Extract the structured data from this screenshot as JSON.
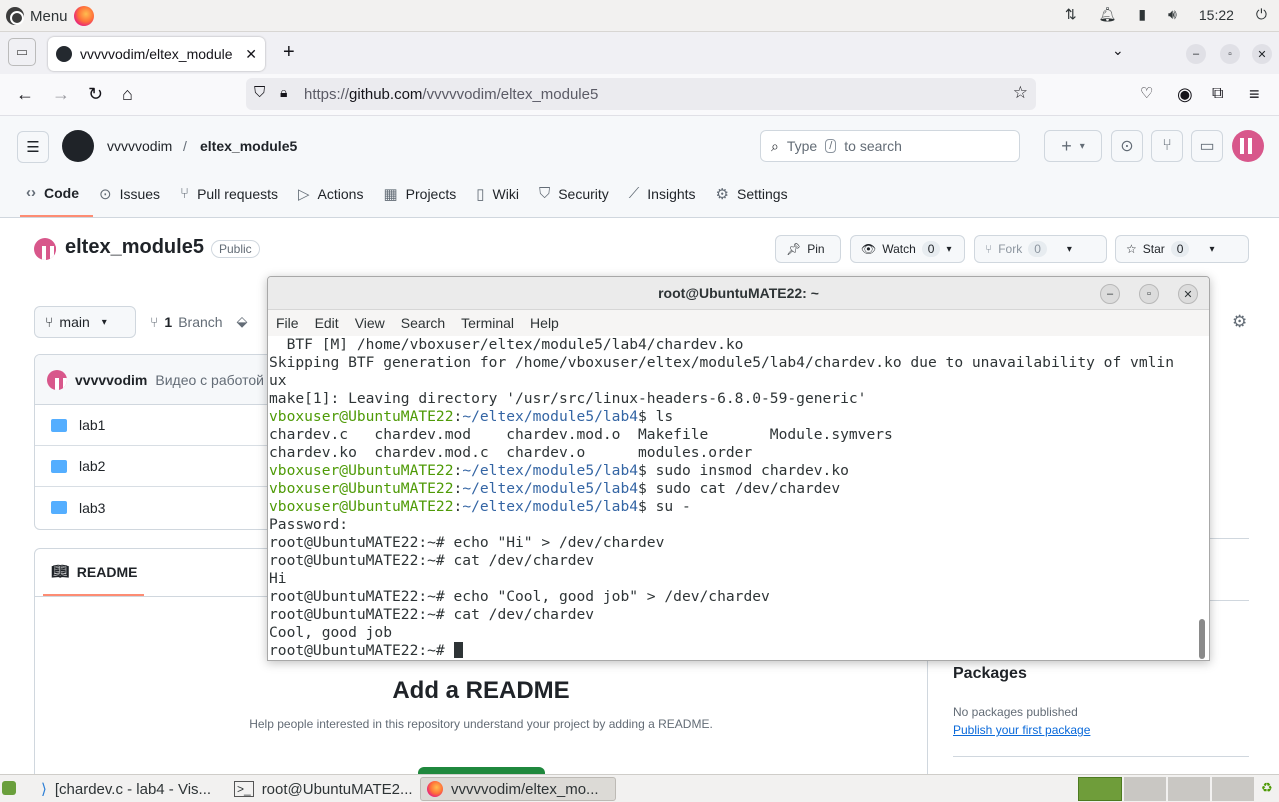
{
  "top_panel": {
    "menu_label": "Menu",
    "clock": "15:22"
  },
  "browser": {
    "tab_title": "vvvvvodim/eltex_module",
    "url_prefix": "https://",
    "url_domain": "github.com",
    "url_path": "/vvvvvodim/eltex_module5"
  },
  "github": {
    "owner": "vvvvvodim",
    "separator": "/",
    "repo": "eltex_module5",
    "search_prefix": "Type",
    "search_key": "/",
    "search_suffix": "to search",
    "nav": [
      {
        "label": "Code"
      },
      {
        "label": "Issues"
      },
      {
        "label": "Pull requests"
      },
      {
        "label": "Actions"
      },
      {
        "label": "Projects"
      },
      {
        "label": "Wiki"
      },
      {
        "label": "Security"
      },
      {
        "label": "Insights"
      },
      {
        "label": "Settings"
      }
    ],
    "repo_title": "eltex_module5",
    "visibility": "Public",
    "pin_label": "Pin",
    "watch_label": "Watch",
    "watch_count": "0",
    "fork_label": "Fork",
    "fork_count": "0",
    "star_label": "Star",
    "star_count": "0",
    "branch_name": "main",
    "branch_count": "1",
    "branch_label": "Branch",
    "commit_author": "vvvvvodim",
    "commit_message": "Видео с работой",
    "files": [
      "lab1",
      "lab2",
      "lab3"
    ],
    "readme_tab": "README",
    "add_readme_title": "Add a README",
    "add_readme_text": "Help people interested in this repository understand your project by adding a README.",
    "packages_title": "Packages",
    "packages_text": "No packages published",
    "packages_link": "Publish your first package"
  },
  "terminal": {
    "title": "root@UbuntuMATE22: ~",
    "menu": [
      "File",
      "Edit",
      "View",
      "Search",
      "Terminal",
      "Help"
    ],
    "lines": [
      {
        "text": "  BTF [M] /home/vboxuser/eltex/module5/lab4/chardev.ko"
      },
      {
        "text": "Skipping BTF generation for /home/vboxuser/eltex/module5/lab4/chardev.ko due to unavailability of vmlin"
      },
      {
        "text": "ux"
      },
      {
        "text": "make[1]: Leaving directory '/usr/src/linux-headers-6.8.0-59-generic'"
      },
      {
        "user": "vboxuser@UbuntuMATE22",
        "colon": ":",
        "path": "~/eltex/module5/lab4",
        "cmd": "$ ls"
      },
      {
        "text": "chardev.c   chardev.mod    chardev.mod.o  Makefile       Module.symvers"
      },
      {
        "text": "chardev.ko  chardev.mod.c  chardev.o      modules.order"
      },
      {
        "user": "vboxuser@UbuntuMATE22",
        "colon": ":",
        "path": "~/eltex/module5/lab4",
        "cmd": "$ sudo insmod chardev.ko"
      },
      {
        "user": "vboxuser@UbuntuMATE22",
        "colon": ":",
        "path": "~/eltex/module5/lab4",
        "cmd": "$ sudo cat /dev/chardev"
      },
      {
        "user": "vboxuser@UbuntuMATE22",
        "colon": ":",
        "path": "~/eltex/module5/lab4",
        "cmd": "$ su -"
      },
      {
        "text": "Password:"
      },
      {
        "text": "root@UbuntuMATE22:~# echo \"Hi\" > /dev/chardev"
      },
      {
        "text": "root@UbuntuMATE22:~# cat /dev/chardev"
      },
      {
        "text": "Hi"
      },
      {
        "text": "root@UbuntuMATE22:~# echo \"Cool, good job\" > /dev/chardev"
      },
      {
        "text": "root@UbuntuMATE22:~# cat /dev/chardev"
      },
      {
        "text": "Cool, good job"
      },
      {
        "text": "root@UbuntuMATE22:~# "
      }
    ]
  },
  "taskbar": {
    "tasks": [
      {
        "label": "[chardev.c - lab4 - Vis..."
      },
      {
        "label": "root@UbuntuMATE2..."
      },
      {
        "label": "vvvvvodim/eltex_mo..."
      }
    ]
  }
}
